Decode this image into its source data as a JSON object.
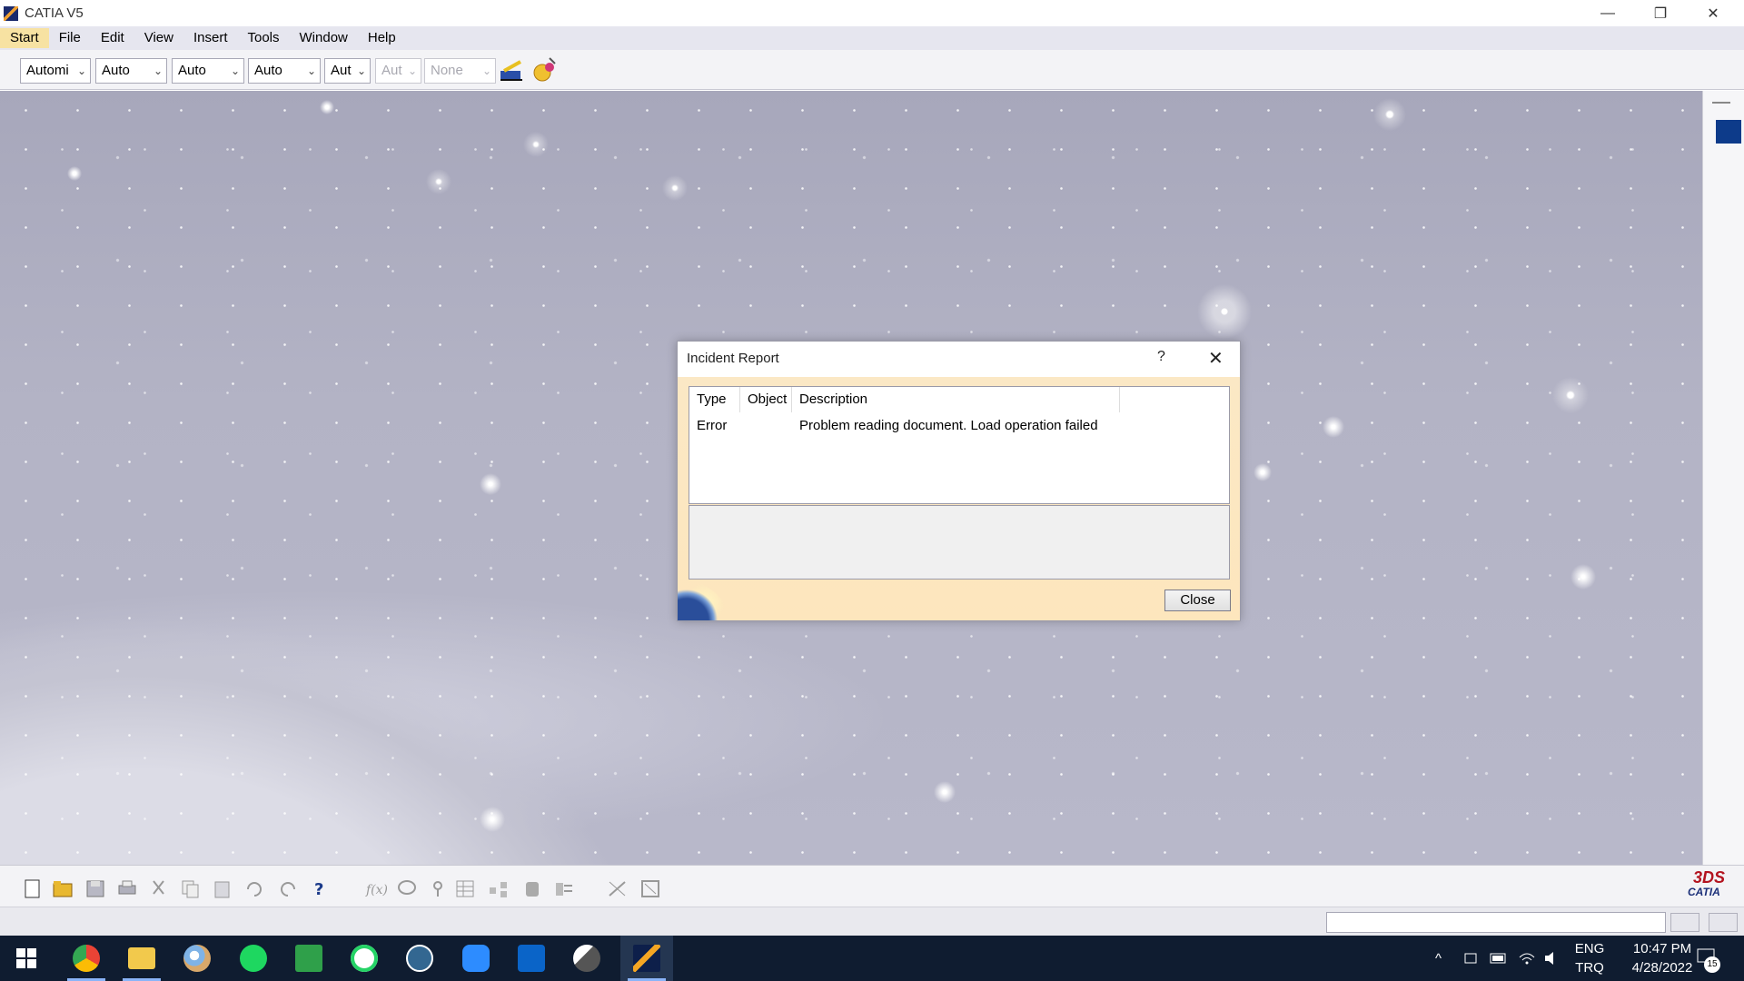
{
  "window": {
    "title": "CATIA V5",
    "minimize": "—",
    "restore": "❐",
    "close": "✕"
  },
  "menubar": {
    "items": [
      "Start",
      "File",
      "Edit",
      "View",
      "Insert",
      "Tools",
      "Window",
      "Help"
    ]
  },
  "toolbar": {
    "combos": [
      {
        "value": "Automi",
        "disabled": false
      },
      {
        "value": "Auto",
        "disabled": false
      },
      {
        "value": "Auto",
        "disabled": false
      },
      {
        "value": "Auto",
        "disabled": false
      },
      {
        "value": "Aut",
        "disabled": false
      },
      {
        "value": "Aut",
        "disabled": true
      },
      {
        "value": "None",
        "disabled": true
      }
    ]
  },
  "dialog": {
    "title": "Incident Report",
    "help": "?",
    "close_x": "✕",
    "columns": [
      "Type",
      "Object",
      "Description"
    ],
    "rows": [
      {
        "type": "Error",
        "object": "",
        "description": "Problem reading document. Load operation failed"
      }
    ],
    "close_button": "Close"
  },
  "bottom_toolbar": {
    "icons": [
      "new-document-icon",
      "open-folder-icon",
      "save-icon",
      "print-icon",
      "cut-icon",
      "copy-icon",
      "paste-icon",
      "undo-icon",
      "redo-icon",
      "whats-this-help-icon",
      "formula-icon",
      "comment-icon",
      "knowledge-icon",
      "table-icon",
      "product-structure-icon",
      "catalog-icon",
      "settings-icon",
      "measure-icon",
      "fit-all-icon"
    ],
    "logo_top": "3DS",
    "logo_text": "CATIA"
  },
  "taskbar": {
    "apps": [
      "start-windows-icon",
      "chrome-icon",
      "file-explorer-icon",
      "paint-icon",
      "spotify-icon",
      "chart-app-icon",
      "whatsapp-icon",
      "postgresql-icon",
      "zoom-icon",
      "outlook-icon",
      "inkscape-icon",
      "catia-icon"
    ],
    "lang_top": "ENG",
    "lang_bottom": "TRQ",
    "time": "10:47 PM",
    "date": "4/28/2022",
    "notifications": "15"
  }
}
